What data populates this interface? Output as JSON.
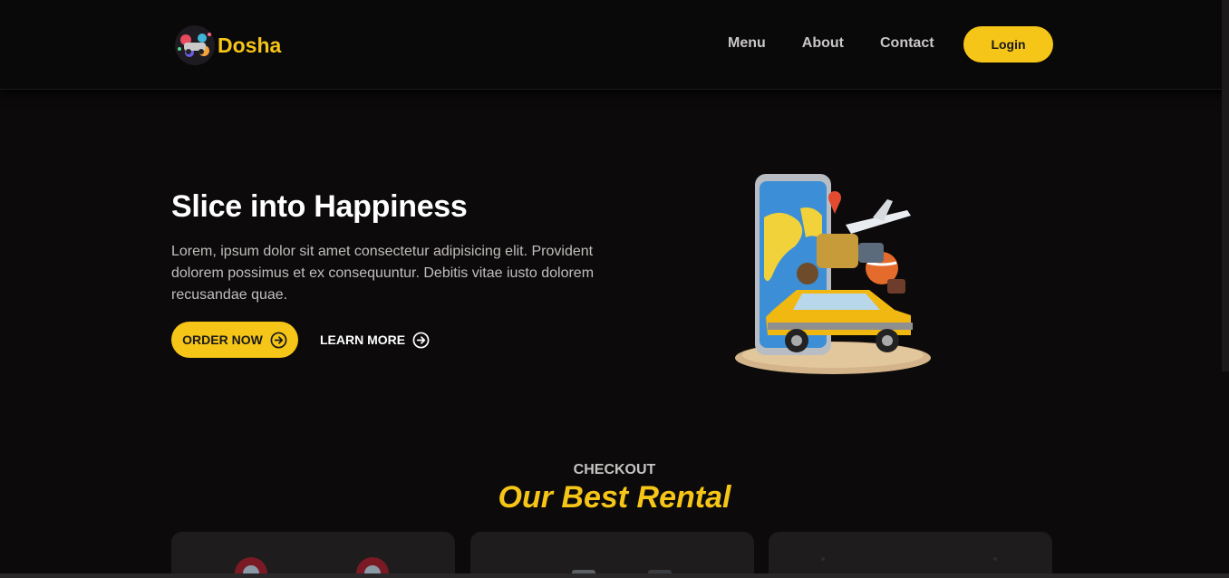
{
  "brand": {
    "name": "Dosha",
    "accent": "#f5c518"
  },
  "nav": {
    "items": [
      "Menu",
      "About",
      "Contact"
    ],
    "login_label": "Login"
  },
  "hero": {
    "title": "Slice into Happiness",
    "description": "Lorem, ipsum dolor sit amet consectetur adipisicing elit. Provident dolorem possimus et ex consequuntur. Debitis vitae iusto dolorem recusandae quae.",
    "order_label": "ORDER NOW",
    "learn_label": "LEARN MORE",
    "image_icon": "travel-phone-car-illustration"
  },
  "section": {
    "eyebrow": "CHECKOUT",
    "title": "Our Best Rental"
  },
  "cards": [
    {
      "image_icon": "red-motorbike-image"
    },
    {
      "image_icon": "car-image"
    },
    {
      "image_icon": "vehicle-image"
    }
  ]
}
